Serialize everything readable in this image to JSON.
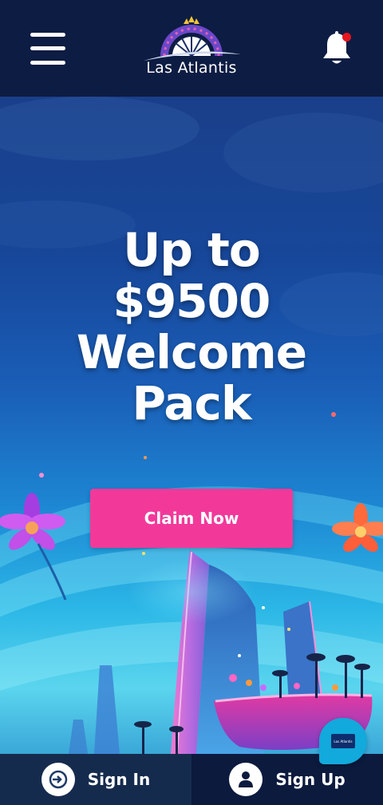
{
  "header": {
    "brand": "Las Atlantis",
    "menu_icon": "hamburger-menu-icon",
    "notification_icon": "bell-icon",
    "notification_dot_color": "#e8161e"
  },
  "hero": {
    "headline_lines": [
      "Up to",
      "$9500",
      "Welcome",
      "Pack"
    ],
    "cta_label": "Claim Now",
    "cta_color": "#f2399a"
  },
  "chat": {
    "icon": "chat-bubble-icon",
    "logo_text": "Las Atlantis"
  },
  "bottom_bar": {
    "signin_label": "Sign In",
    "signin_icon": "sign-in-arrow-icon",
    "signup_label": "Sign Up",
    "signup_icon": "user-icon"
  }
}
